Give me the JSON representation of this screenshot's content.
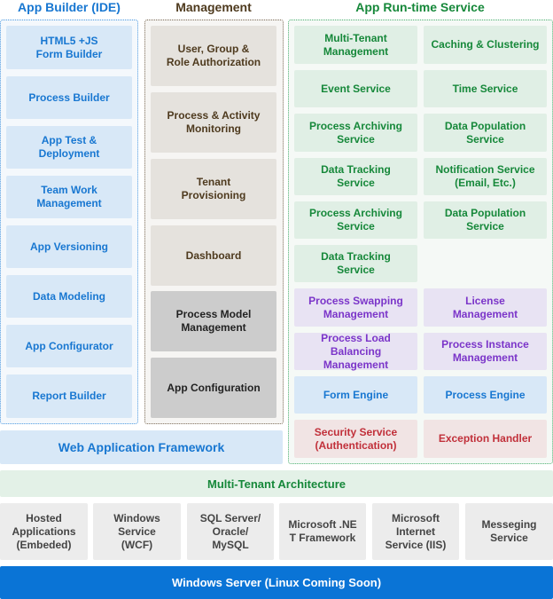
{
  "columns": {
    "app_builder": {
      "title": "App Builder (IDE)",
      "items": [
        "HTML5 +JS\nForm Builder",
        "Process Builder",
        "App Test &\nDeployment",
        "Team Work\nManagement",
        "App Versioning",
        "Data Modeling",
        "App Configurator",
        "Report Builder"
      ]
    },
    "management": {
      "title": "Management",
      "items": [
        "User, Group &\nRole Authorization",
        "Process & Activity\nMonitoring",
        "Tenant\nProvisioning",
        "Dashboard",
        "Process Model\nManagement",
        "App Configuration"
      ]
    },
    "runtime": {
      "title": "App Run-time Service",
      "items": [
        "Multi-Tenant\nManagement",
        "Caching & Clustering",
        "Event Service",
        "Time Service",
        "Process Archiving\nService",
        "Data Population\nService",
        "Data Tracking\nService",
        "Notification Service\n(Email, Etc.)",
        "Process Archiving\nService",
        "Data Population\nService",
        "Data Tracking\nService",
        "Process Swapping\nManagement",
        "License\nManagement",
        "Process Load Balancing\nManagement",
        "Process Instance\nManagement",
        "Form Engine",
        "Process Engine",
        "Security Service\n(Authentication)",
        "Exception Handler"
      ]
    }
  },
  "web_framework": "Web Application Framework",
  "multi_tenant": "Multi-Tenant Architecture",
  "platform": [
    "Hosted\nApplications\n(Embeded)",
    "Windows\nService\n(WCF)",
    "SQL Server/\nOracle/\nMySQL",
    "Microsoft .NE\nT Framework",
    "Microsoft\nInternet\nService (IIS)",
    "Messeging\nService"
  ],
  "server": "Windows Server (Linux Coming Soon)",
  "colors": {
    "blue": "#1877d1",
    "brown": "#4e3a1e",
    "green": "#16883a",
    "purple": "#7b35c9",
    "red": "#c1303a",
    "server_bg": "#0a74d6"
  }
}
